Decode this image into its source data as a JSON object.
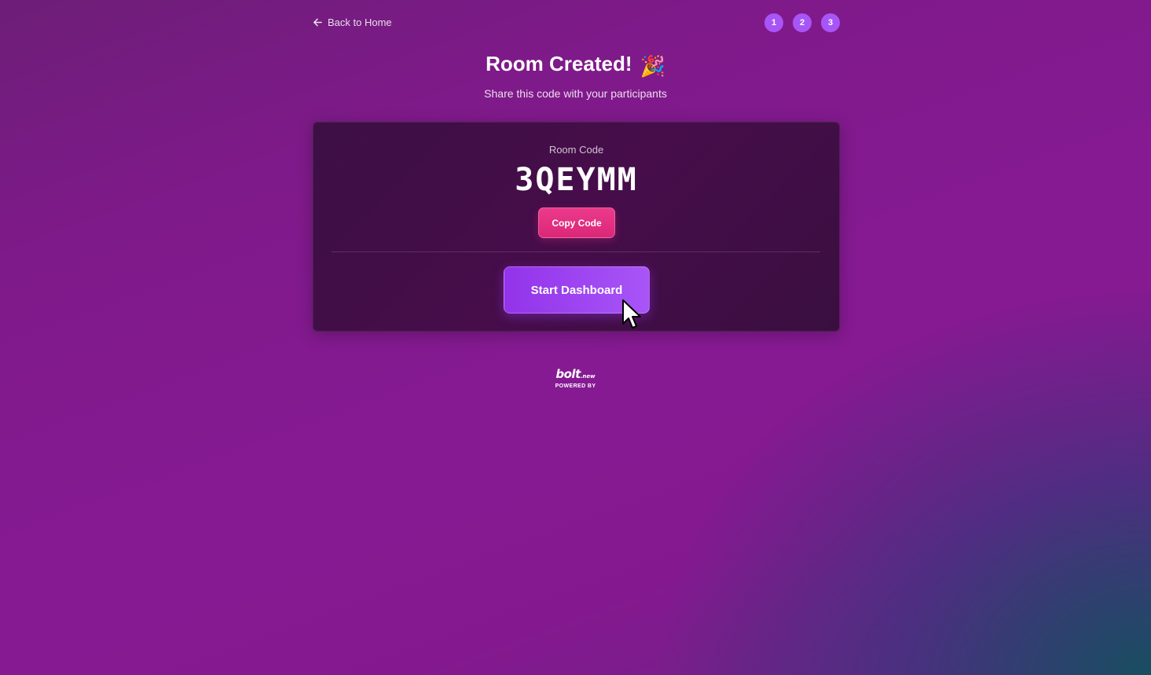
{
  "header": {
    "back_label": "Back to Home",
    "steps": [
      "1",
      "2",
      "3"
    ]
  },
  "title": {
    "text": "Room Created!",
    "emoji": "🎉",
    "subtitle": "Share this code with your participants"
  },
  "card": {
    "room_label": "Room Code",
    "room_code": "3QEYMM",
    "copy_label": "Copy Code",
    "start_label": "Start Dashboard"
  },
  "footer": {
    "logo": "bolt",
    "logo_suffix": ".new",
    "powered_by": "POWERED BY"
  },
  "colors": {
    "step_badge": "#a855f7",
    "copy_button": "#db2777",
    "start_button": "#9333ea",
    "card_bg": "#410d48"
  },
  "icons": {
    "back": "arrow-left-icon",
    "cursor": "mouse-pointer-icon"
  }
}
